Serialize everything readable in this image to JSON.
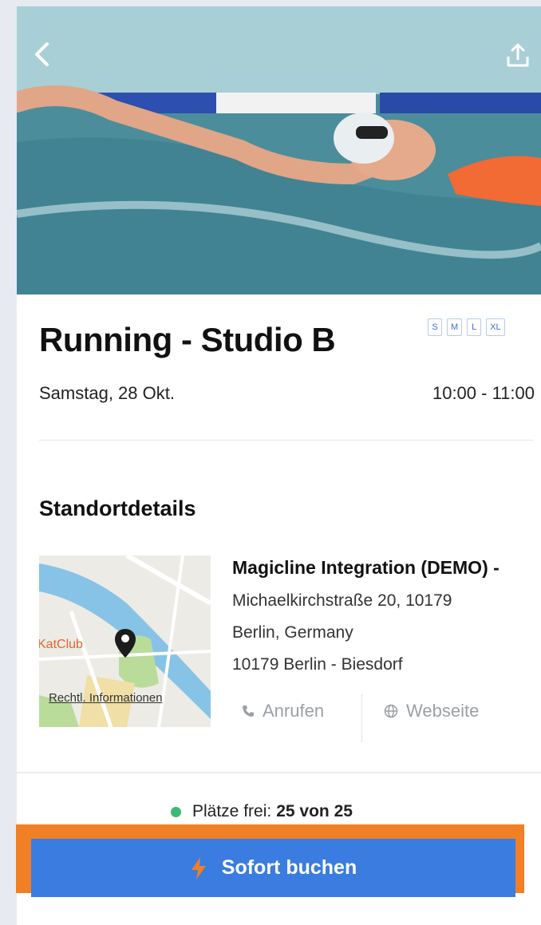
{
  "event": {
    "title": "Running - Studio B",
    "sizes": [
      "S",
      "M",
      "L",
      "XL"
    ],
    "date": "Samstag, 28 Okt.",
    "time": "10:00 - 11:00"
  },
  "location": {
    "section_title": "Standortdetails",
    "name": "Magicline Integration (DEMO) -",
    "street": "Michaelkirchstraße 20, 10179",
    "city_country": "Berlin, Germany",
    "district": "10179 Berlin - Biesdorf",
    "map_legal": "Rechtl. Informationen",
    "map_club_label": "KatClub",
    "call_label": "Anrufen",
    "website_label": "Webseite"
  },
  "availability": {
    "label": "Plätze frei:",
    "value": "25 von 25",
    "status_color": "#3dba74"
  },
  "booking": {
    "button_label": "Sofort buchen",
    "button_color": "#3a7ce0",
    "highlight_color": "#f07f25"
  },
  "icons": [
    "back-arrow-icon",
    "share-icon",
    "phone-icon",
    "globe-icon",
    "lightning-icon",
    "map-pin-icon"
  ]
}
